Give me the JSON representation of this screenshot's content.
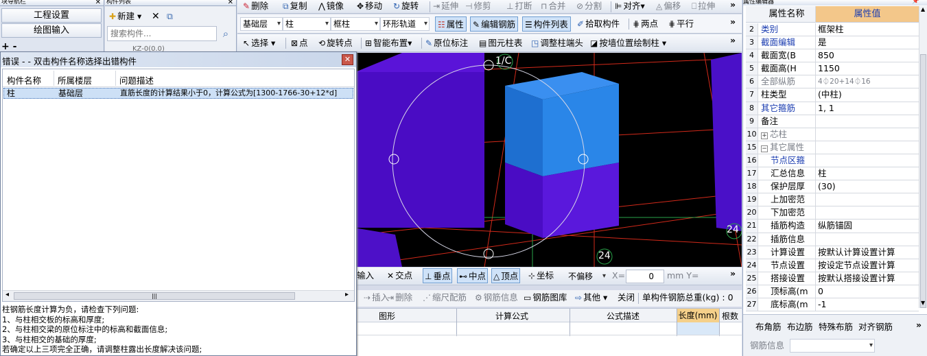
{
  "nav_panel": {
    "title": "块导航栏",
    "items": [
      "工程设置",
      "绘图输入"
    ]
  },
  "component_list": {
    "title": "构件列表",
    "new_label": "新建",
    "search_placeholder": "搜索构件...",
    "tree_item": "KZ-0(0.0)"
  },
  "toolbar1": [
    "删除",
    "复制",
    "镜像",
    "移动",
    "旋转",
    "延伸",
    "修剪",
    "打断",
    "合并",
    "分割",
    "对齐",
    "偏移",
    "拉伸"
  ],
  "toolbar2": {
    "floor": "基础层",
    "type": "柱",
    "subtype": "框柱",
    "axis": "环形轨道",
    "buttons": [
      "属性",
      "编辑钢筋",
      "构件列表",
      "拾取构件",
      "两点",
      "平行"
    ]
  },
  "toolbar3": [
    "选择",
    "点",
    "旋转点",
    "智能布置",
    "原位标注",
    "图元柱表",
    "调整柱端头",
    "按墙位置绘制柱"
  ],
  "canvas": {
    "labels": [
      "1/C",
      "24",
      "24"
    ]
  },
  "error_dialog": {
    "title": "错误 - - 双击构件名称选择出错构件",
    "columns": [
      "构件名称",
      "所属楼层",
      "问题描述"
    ],
    "rows": [
      {
        "name": "柱",
        "floor": "基础层",
        "desc": "直筋长度的计算结果小于0，计算公式为[1300-1766-30+12*d]"
      }
    ],
    "message": [
      "柱钢筋长度计算为负，请检查下列问题:",
      "1、与柱相交板的标高和厚度;",
      "2、与柱相交梁的原位标注中的标高和截面信息;",
      "3、与柱相交的基础的厚度;",
      "若确定以上三项完全正确，请调整柱露出长度解决该问题;"
    ]
  },
  "snap_bar": {
    "prefix": "输入",
    "items": [
      "交点",
      "垂点",
      "中点",
      "顶点",
      "坐标"
    ],
    "offset": "不偏移",
    "x_label": "X=",
    "x_value": "0",
    "unit": "mm Y="
  },
  "rebar_toolbar": {
    "items": [
      "插入",
      "删除",
      "缩尺配筋",
      "钢筋信息",
      "钢筋图库",
      "其他",
      "关闭"
    ],
    "total": "单构件钢筋总重(kg) : 0"
  },
  "rebar_table": {
    "columns": [
      "图形",
      "计算公式",
      "公式描述",
      "长度(mm)",
      "根数"
    ]
  },
  "property_editor": {
    "title": "属性编辑器",
    "headers": [
      "属性名称",
      "属性值"
    ],
    "rows": [
      {
        "n": "2",
        "name": "类别",
        "val": "框架柱",
        "style": "blue"
      },
      {
        "n": "3",
        "name": "截面编辑",
        "val": "是",
        "style": "blue"
      },
      {
        "n": "4",
        "name": "截面宽(B",
        "val": "850",
        "style": ""
      },
      {
        "n": "5",
        "name": "截面高(H",
        "val": "1150",
        "style": ""
      },
      {
        "n": "6",
        "name": "全部纵筋",
        "val": "4⏀20+14⏀16",
        "style": "gray"
      },
      {
        "n": "7",
        "name": "柱类型",
        "val": "(中柱)",
        "style": ""
      },
      {
        "n": "8",
        "name": "其它箍筋",
        "val": "1, 1",
        "style": "blue"
      },
      {
        "n": "9",
        "name": "备注",
        "val": "",
        "style": ""
      },
      {
        "n": "10",
        "name": "芯柱",
        "val": "",
        "style": "gray",
        "toggle": "+"
      },
      {
        "n": "15",
        "name": "其它属性",
        "val": "",
        "style": "gray",
        "toggle": "−"
      },
      {
        "n": "16",
        "name": "节点区箍",
        "val": "",
        "style": "blue",
        "indent": true
      },
      {
        "n": "17",
        "name": "汇总信息",
        "val": "柱",
        "style": "",
        "indent": true
      },
      {
        "n": "18",
        "name": "保护层厚",
        "val": "(30)",
        "style": "",
        "indent": true
      },
      {
        "n": "19",
        "name": "上加密范",
        "val": "",
        "style": "",
        "indent": true
      },
      {
        "n": "20",
        "name": "下加密范",
        "val": "",
        "style": "",
        "indent": true
      },
      {
        "n": "21",
        "name": "插筋构造",
        "val": "纵筋锚固",
        "style": "",
        "indent": true
      },
      {
        "n": "22",
        "name": "插筋信息",
        "val": "",
        "style": "",
        "indent": true
      },
      {
        "n": "23",
        "name": "计算设置",
        "val": "按默认计算设置计算",
        "style": "",
        "indent": true
      },
      {
        "n": "24",
        "name": "节点设置",
        "val": "按设定节点设置计算",
        "style": "",
        "indent": true
      },
      {
        "n": "25",
        "name": "搭接设置",
        "val": "按默认搭接设置计算",
        "style": "",
        "indent": true
      },
      {
        "n": "26",
        "name": "顶标高(m",
        "val": "0",
        "style": "",
        "indent": true
      },
      {
        "n": "27",
        "name": "底标高(m",
        "val": "-1",
        "style": "",
        "indent": true
      }
    ],
    "bottom_buttons": [
      "布角筋",
      "布边筋",
      "特殊布筋",
      "对齐钢筋"
    ],
    "rebar_info_label": "钢筋信息"
  },
  "colors": {
    "canvas_bg": "#000000",
    "column_purple": "#5a0fd6",
    "column_blue": "#1f7fe0",
    "highlight": "#cfe2f8"
  }
}
